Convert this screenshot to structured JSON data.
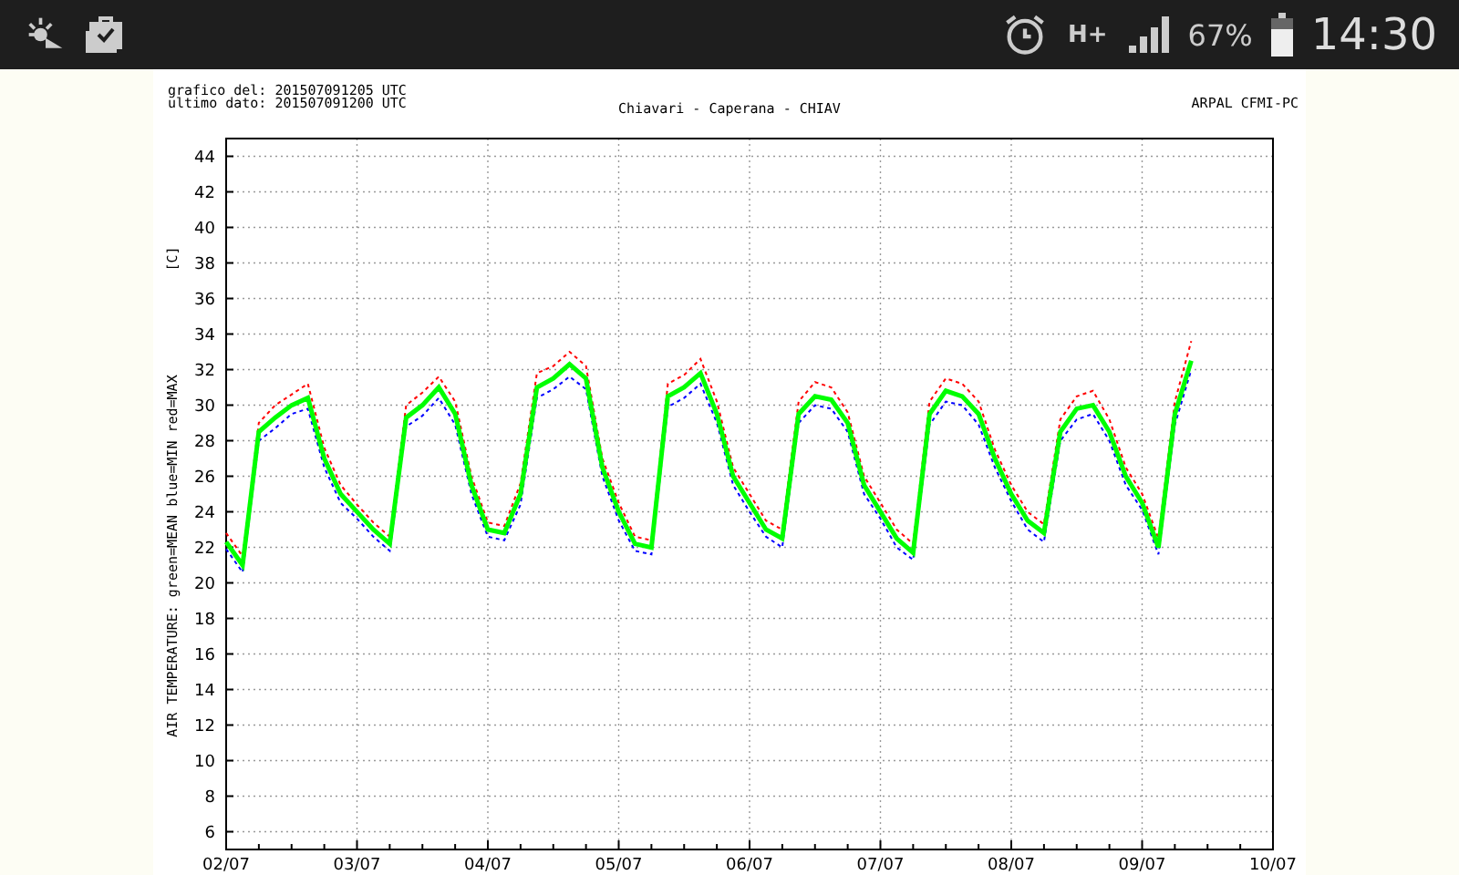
{
  "status_bar": {
    "network": "H+",
    "battery_text": "67%",
    "time": "14:30"
  },
  "chart": {
    "header_left": [
      "grafico del: 201507091205 UTC",
      "ultimo dato: 201507091200 UTC"
    ],
    "header_right": "ARPAL CFMI-PC",
    "unit": "[C]",
    "chart_data": {
      "type": "line",
      "title": "Chiavari - Caperana - CHIAV",
      "ylabel": "AIR TEMPERATURE: green=MEAN  blue=MIN  red=MAX",
      "grid": true,
      "ylim": [
        5,
        45
      ],
      "yticks": [
        6,
        8,
        10,
        12,
        14,
        16,
        18,
        20,
        22,
        24,
        26,
        28,
        30,
        32,
        34,
        36,
        38,
        40,
        42,
        44
      ],
      "categories": [
        "02/07",
        null,
        null,
        null,
        null,
        null,
        null,
        null,
        "03/07",
        null,
        null,
        null,
        null,
        null,
        null,
        null,
        "04/07",
        null,
        null,
        null,
        null,
        null,
        null,
        null,
        "05/07",
        null,
        null,
        null,
        null,
        null,
        null,
        null,
        "06/07",
        null,
        null,
        null,
        null,
        null,
        null,
        null,
        "07/07",
        null,
        null,
        null,
        null,
        null,
        null,
        null,
        "08/07",
        null,
        null,
        null,
        null,
        null,
        null,
        null,
        "09/07",
        null,
        null,
        null,
        null,
        null,
        null,
        null,
        "10/07"
      ],
      "series": [
        {
          "color": "#ff0000",
          "line_style": "dashed",
          "values": [
            22.8,
            21.5,
            29.0,
            30.0,
            30.6,
            31.2,
            27.6,
            25.5,
            24.4,
            23.4,
            22.6,
            30.0,
            30.7,
            31.6,
            30.2,
            26.0,
            23.4,
            23.2,
            25.6,
            31.8,
            32.2,
            33.0,
            32.2,
            27.0,
            24.5,
            22.6,
            22.4,
            31.2,
            31.7,
            32.6,
            30.2,
            26.5,
            25.0,
            23.5,
            23.0,
            30.2,
            31.3,
            31.0,
            29.6,
            26.0,
            24.5,
            23.0,
            22.2,
            30.2,
            31.5,
            31.2,
            30.2,
            27.5,
            25.5,
            24.0,
            23.3,
            29.2,
            30.5,
            30.8,
            29.2,
            26.5,
            25.0,
            22.5,
            30.2,
            33.6,
            null,
            null,
            null,
            null,
            null
          ]
        },
        {
          "color": "#0000ff",
          "line_style": "dashed",
          "values": [
            21.9,
            20.6,
            28.0,
            28.7,
            29.5,
            29.8,
            26.5,
            24.5,
            23.6,
            22.6,
            21.8,
            28.8,
            29.4,
            30.4,
            28.9,
            25.0,
            22.6,
            22.4,
            24.4,
            30.4,
            30.9,
            31.6,
            30.9,
            26.0,
            23.5,
            21.8,
            21.6,
            29.9,
            30.4,
            31.2,
            29.0,
            25.5,
            24.0,
            22.6,
            22.0,
            29.0,
            30.0,
            29.8,
            28.5,
            25.0,
            23.6,
            22.0,
            21.3,
            28.9,
            30.2,
            30.0,
            28.9,
            26.5,
            24.6,
            23.0,
            22.3,
            28.0,
            29.2,
            29.5,
            28.0,
            25.5,
            24.1,
            21.6,
            28.9,
            32.0,
            null,
            null,
            null,
            null,
            null
          ]
        },
        {
          "color": "#00ff00",
          "line_style": "solid",
          "values": [
            22.3,
            21.0,
            28.5,
            29.3,
            30.0,
            30.4,
            27.0,
            25.0,
            24.0,
            23.0,
            22.2,
            29.3,
            30.0,
            31.0,
            29.5,
            25.5,
            23.0,
            22.8,
            25.0,
            31.0,
            31.5,
            32.3,
            31.5,
            26.5,
            24.0,
            22.2,
            22.0,
            30.5,
            31.0,
            31.8,
            29.5,
            26.0,
            24.5,
            23.0,
            22.5,
            29.5,
            30.5,
            30.3,
            29.0,
            25.5,
            24.0,
            22.5,
            21.7,
            29.5,
            30.8,
            30.5,
            29.5,
            27.0,
            25.0,
            23.5,
            22.8,
            28.5,
            29.8,
            30.0,
            28.5,
            26.0,
            24.5,
            22.0,
            29.5,
            32.5,
            null,
            null,
            null,
            null,
            null
          ]
        }
      ]
    }
  }
}
